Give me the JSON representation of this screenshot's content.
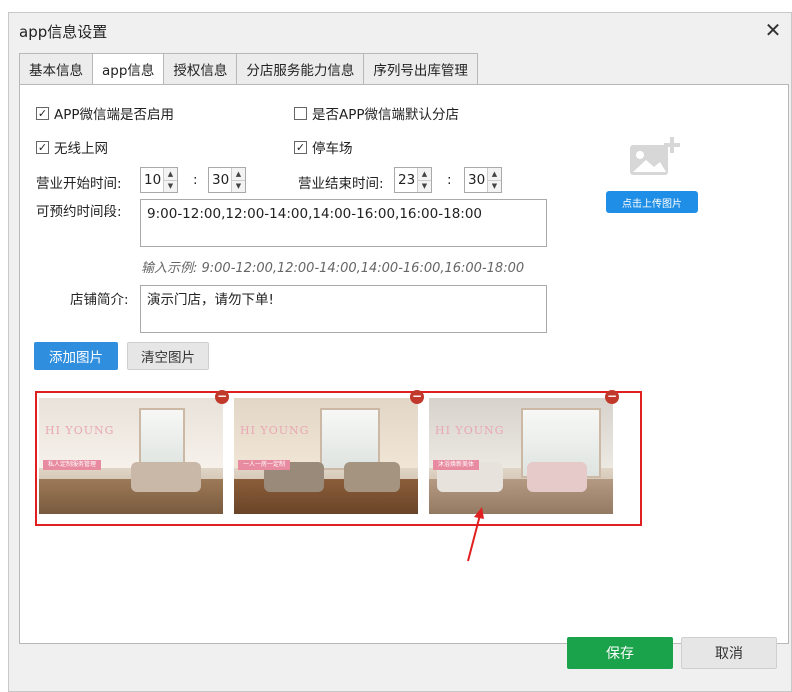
{
  "window": {
    "title": "app信息设置",
    "close_glyph": "✕"
  },
  "tabs": [
    {
      "label": "基本信息",
      "active": false
    },
    {
      "label": "app信息",
      "active": true
    },
    {
      "label": "授权信息",
      "active": false
    },
    {
      "label": "分店服务能力信息",
      "active": false
    },
    {
      "label": "序列号出库管理",
      "active": false
    }
  ],
  "form": {
    "app_wechat_enabled": {
      "label": "APP微信端是否启用",
      "checked": true
    },
    "app_wechat_default_store": {
      "label": "是否APP微信端默认分店",
      "checked": false
    },
    "wifi": {
      "label": "无线上网",
      "checked": true
    },
    "parking": {
      "label": "停车场",
      "checked": true
    },
    "business_start": {
      "label": "营业开始时间:",
      "hour": "10",
      "minute": "30"
    },
    "business_end": {
      "label": "营业结束时间:",
      "hour": "23",
      "minute": "30"
    },
    "time_separator": ":",
    "reservation": {
      "label": "可预约时间段:",
      "value": "9:00-12:00,12:00-14:00,14:00-16:00,16:00-18:00",
      "hint": "输入示例:  9:00-12:00,12:00-14:00,14:00-16:00,16:00-18:00"
    },
    "store_intro": {
      "label": "店铺简介:",
      "value": "演示门店，请勿下单!"
    }
  },
  "upload": {
    "icon": "image-add-icon",
    "button_label": "点击上传图片"
  },
  "images": {
    "add_label": "添加图片",
    "clear_label": "清空图片",
    "photos": [
      {
        "brand": "HI YOUNG",
        "banner": "私人定制服务管理",
        "remove_glyph": "−"
      },
      {
        "brand": "HI YOUNG",
        "banner": "一人一房一定制",
        "remove_glyph": "−"
      },
      {
        "brand": "HI YOUNG",
        "banner": "沐浴焕新美体",
        "remove_glyph": "−"
      }
    ]
  },
  "footer": {
    "save_label": "保存",
    "cancel_label": "取消"
  },
  "colors": {
    "primary_blue": "#2f8fde",
    "save_green": "#1aa34a",
    "highlight_red": "#e02020"
  }
}
